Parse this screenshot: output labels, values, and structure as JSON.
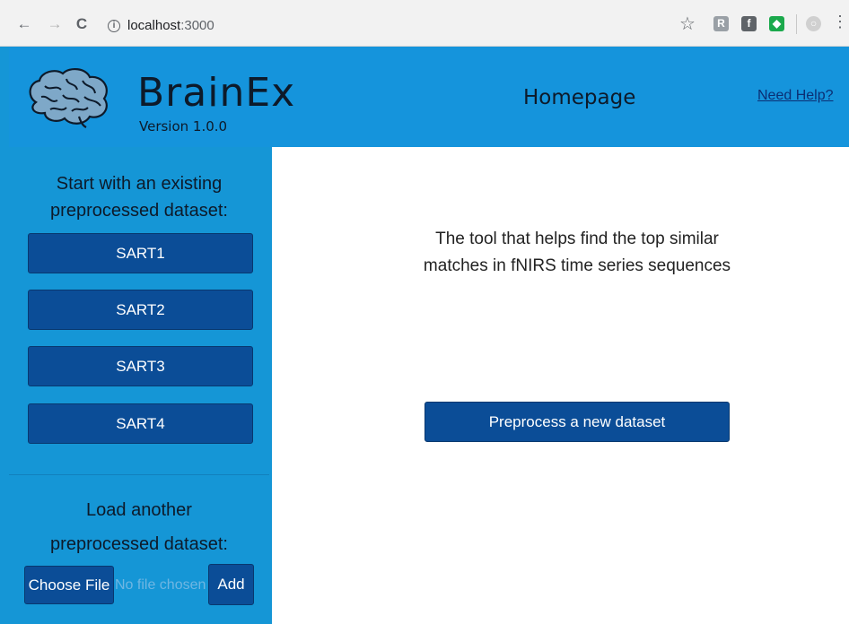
{
  "browser": {
    "url_host": "localhost",
    "url_port": ":3000",
    "back_icon": "←",
    "forward_icon": "→",
    "reload_icon": "C",
    "info_icon": "i",
    "star_icon": "☆",
    "menu_icon": "⋮",
    "ext_icons": [
      "R",
      "f",
      "◆",
      "○"
    ]
  },
  "header": {
    "brand": "BrainEx",
    "version": "Version 1.0.0",
    "page_title": "Homepage",
    "help_link": "Need Help?"
  },
  "sidebar": {
    "existing_title": "Start with an existing preprocessed dataset:",
    "datasets": [
      "SART1",
      "SART2",
      "SART3",
      "SART4"
    ],
    "load_title_line1": "Load another",
    "load_title_line2": "preprocessed dataset:",
    "choose_file": "Choose File",
    "file_status": "No file chosen",
    "add_label": "Add"
  },
  "main": {
    "tagline_line1": "The tool that helps find the top similar",
    "tagline_line2": "matches in fNIRS time series sequences",
    "preprocess_button": "Preprocess a new dataset"
  },
  "colors": {
    "brand_blue": "#1596d6",
    "button_blue": "#0b4d97",
    "link_blue": "#0b2f74"
  }
}
